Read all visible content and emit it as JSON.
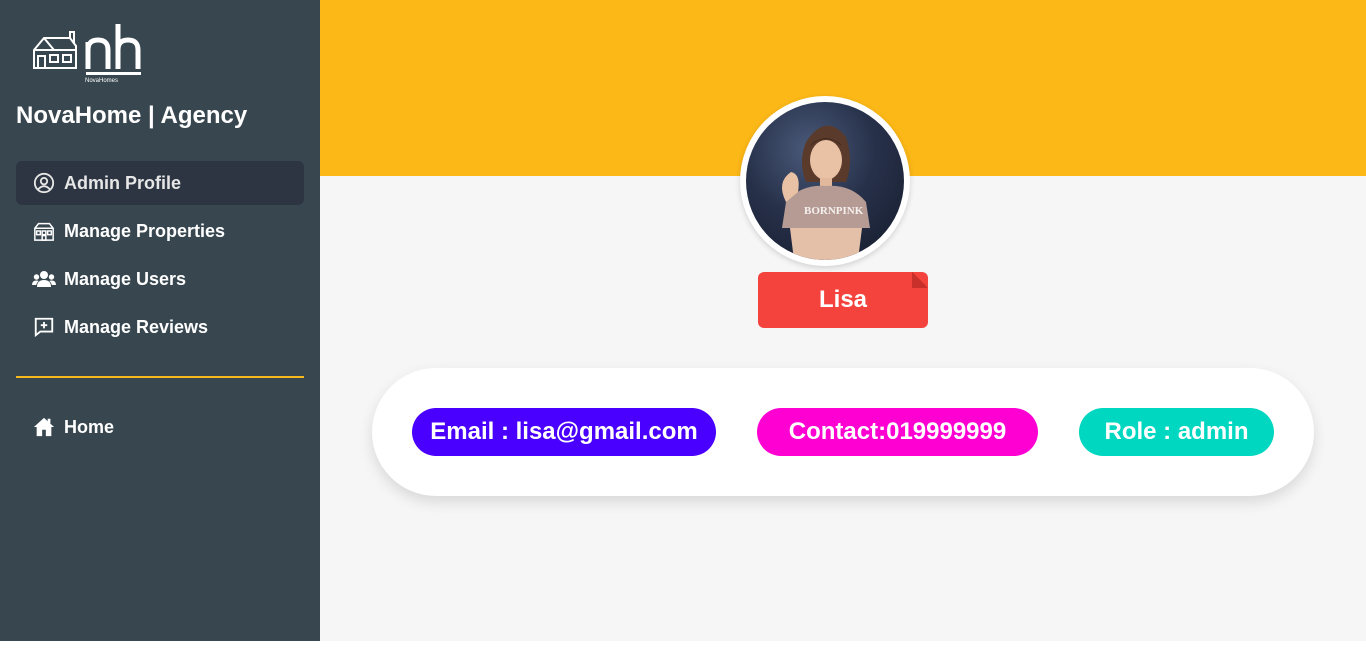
{
  "sidebar": {
    "logo_text": "nh",
    "logo_subtext": "NovaHomes",
    "brand": "NovaHome | Agency",
    "items": [
      {
        "label": "Admin Profile",
        "icon": "user-circle-icon",
        "active": true
      },
      {
        "label": "Manage Properties",
        "icon": "buildings-icon",
        "active": false
      },
      {
        "label": "Manage Users",
        "icon": "users-icon",
        "active": false
      },
      {
        "label": "Manage Reviews",
        "icon": "review-plus-icon",
        "active": false
      }
    ],
    "secondary_items": [
      {
        "label": "Home",
        "icon": "home-icon"
      }
    ]
  },
  "profile": {
    "name": "Lisa",
    "email": "Email : lisa@gmail.com",
    "contact": "Contact:019999999",
    "role": "Role : admin"
  },
  "colors": {
    "sidebar_bg": "#38474f",
    "active_item_bg": "#2c3541",
    "accent_yellow": "#fcb817",
    "name_tag": "#f4433c",
    "email_pill": "#4a00ff",
    "contact_pill": "#ff00d3",
    "role_pill": "#00d7c0"
  }
}
